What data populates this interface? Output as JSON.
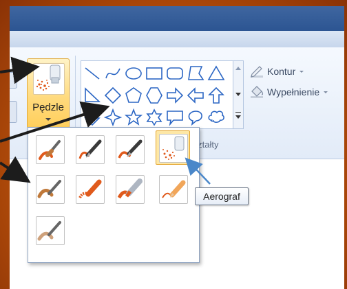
{
  "window": {
    "title": ""
  },
  "ribbon": {
    "brushes": {
      "label": "Pędzle",
      "icon": "airbrush-icon"
    },
    "shapes": {
      "group_label": "Kształty",
      "items": [
        "line-icon",
        "curve-icon",
        "oval-icon",
        "rectangle-icon",
        "rounded-rectangle-icon",
        "polygon-icon",
        "triangle-icon",
        "right-triangle-icon",
        "diamond-icon",
        "pentagon-icon",
        "hexagon-icon",
        "right-arrow-icon",
        "left-arrow-icon",
        "up-arrow-icon",
        "down-arrow-icon",
        "four-point-star-icon",
        "five-point-star-icon",
        "six-point-star-icon",
        "rectangular-callout-icon",
        "oval-callout-icon",
        "cloud-callout-icon"
      ]
    },
    "outline": {
      "label": "Kontur"
    },
    "fill": {
      "label": "Wypełnienie"
    }
  },
  "brush_menu": {
    "items": [
      {
        "name": "brush",
        "icon": "brush-icon"
      },
      {
        "name": "calligraphy-brush-1",
        "icon": "calligraphy-pen-icon"
      },
      {
        "name": "calligraphy-brush-2",
        "icon": "calligraphy-pen-icon"
      },
      {
        "name": "airbrush",
        "icon": "airbrush-icon",
        "selected": true
      },
      {
        "name": "oil-brush",
        "icon": "oil-brush-icon"
      },
      {
        "name": "crayon",
        "icon": "crayon-icon"
      },
      {
        "name": "marker",
        "icon": "marker-icon"
      },
      {
        "name": "natural-pencil",
        "icon": "pencil-icon"
      },
      {
        "name": "watercolor-brush",
        "icon": "watercolor-brush-icon"
      }
    ],
    "tooltip": "Aerograf"
  },
  "colors": {
    "accent": "#f0a531",
    "title_bar": "#2c5592",
    "ribbon_bg": "#e2ebf8",
    "shape_stroke": "#2b66c4",
    "brush_orange": "#e05a1c",
    "arrow": "#1c1c1c",
    "arrow_blue": "#4a87c9",
    "background_orange": "#c8600c"
  }
}
